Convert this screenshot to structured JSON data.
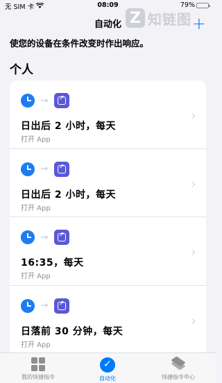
{
  "status_bar": {
    "carrier": "无 SIM 卡",
    "time": "08:09",
    "battery": "79%",
    "battery_level": 0.79
  },
  "nav": {
    "title": "自动化",
    "add_label": "+"
  },
  "watermark": {
    "text": "知链图"
  },
  "subtitle": "使您的设备在条件改变时作出响应。",
  "section": "个人",
  "automations": [
    {
      "title": "日出后 2 小时，每天",
      "subtitle": "打开 App"
    },
    {
      "title": "日出后 2 小时，每天",
      "subtitle": "打开 App"
    },
    {
      "title": "16:35，每天",
      "subtitle": "打开 App"
    },
    {
      "title": "日落前 30 分钟，每天",
      "subtitle": "打开 App"
    }
  ],
  "tabs": [
    {
      "label": "我的快捷指令",
      "icon": "grid-icon",
      "active": false
    },
    {
      "label": "自动化",
      "icon": "check-icon",
      "active": true
    },
    {
      "label": "快捷指令中心",
      "icon": "layers-icon",
      "active": false
    }
  ],
  "colors": {
    "accent": "#007aff",
    "clock": "#1e7cf2",
    "app": "#5b58d6",
    "background": "#f2f2f7"
  }
}
